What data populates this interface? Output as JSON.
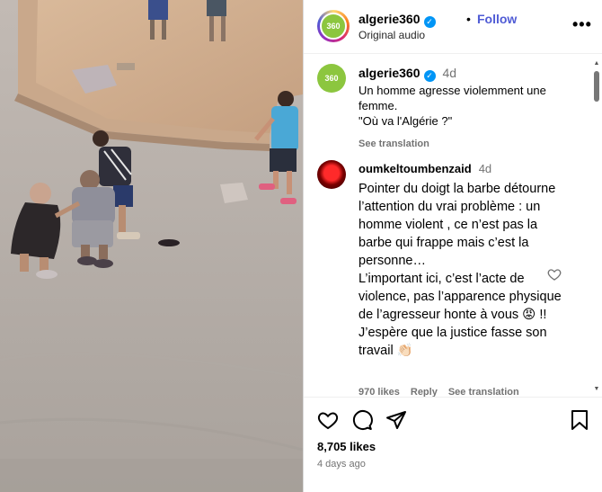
{
  "video": {
    "content": "street-scene-video"
  },
  "header": {
    "avatar_text": "360",
    "username": "algerie360",
    "separator": "•",
    "follow_label": "Follow",
    "audio_label": "Original audio",
    "more_label": "•••"
  },
  "caption": {
    "avatar_text": "360",
    "username": "algerie360",
    "time": "4d",
    "text": "Un homme agresse violemment une femme.\n\"Où va l'Algérie ?\"",
    "see_translation": "See translation"
  },
  "comment": {
    "username": "oumkeltoumbenzaid",
    "time": "4d",
    "text": "Pointer du doigt la barbe détourne l’attention du vrai problème : un homme violent , ce n’est pas la barbe qui frappe mais c’est la personne…\nL’important ici, c’est l’acte de violence, pas l’apparence physique de l’agresseur honte à vous 😡 !!\nJ’espère que la justice fasse son travail 👏🏻",
    "likes": "970 likes",
    "reply": "Reply",
    "see_translation": "See translation"
  },
  "actions": {
    "likes": "8,705 likes",
    "posted": "4 days ago",
    "icons": [
      "heart-icon",
      "comment-icon",
      "share-icon",
      "bookmark-icon"
    ]
  },
  "colors": {
    "follow": "#4f5bd5",
    "brand_avatar": "#8cc63f",
    "verified": "#0095f6",
    "muted": "#737373"
  }
}
